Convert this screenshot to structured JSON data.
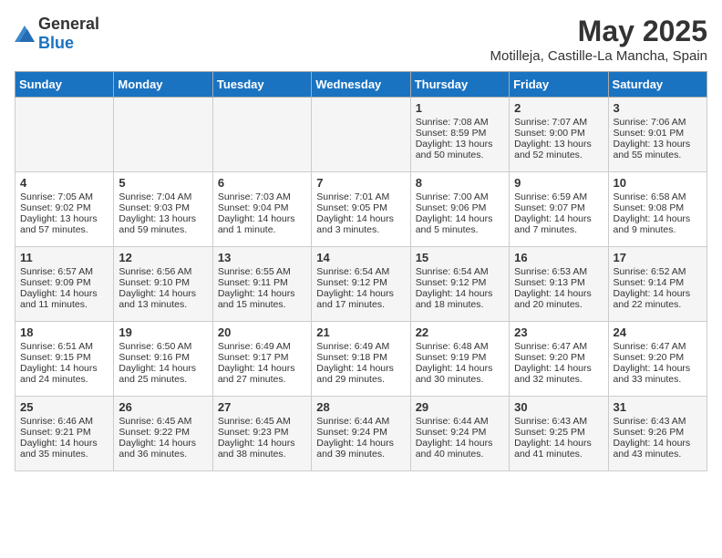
{
  "header": {
    "logo_general": "General",
    "logo_blue": "Blue",
    "title": "May 2025",
    "subtitle": "Motilleja, Castille-La Mancha, Spain"
  },
  "days": [
    "Sunday",
    "Monday",
    "Tuesday",
    "Wednesday",
    "Thursday",
    "Friday",
    "Saturday"
  ],
  "weeks": [
    [
      {
        "date": "",
        "sunrise": "",
        "sunset": "",
        "daylight": ""
      },
      {
        "date": "",
        "sunrise": "",
        "sunset": "",
        "daylight": ""
      },
      {
        "date": "",
        "sunrise": "",
        "sunset": "",
        "daylight": ""
      },
      {
        "date": "",
        "sunrise": "",
        "sunset": "",
        "daylight": ""
      },
      {
        "date": "1",
        "sunrise": "Sunrise: 7:08 AM",
        "sunset": "Sunset: 8:59 PM",
        "daylight": "Daylight: 13 hours and 50 minutes."
      },
      {
        "date": "2",
        "sunrise": "Sunrise: 7:07 AM",
        "sunset": "Sunset: 9:00 PM",
        "daylight": "Daylight: 13 hours and 52 minutes."
      },
      {
        "date": "3",
        "sunrise": "Sunrise: 7:06 AM",
        "sunset": "Sunset: 9:01 PM",
        "daylight": "Daylight: 13 hours and 55 minutes."
      }
    ],
    [
      {
        "date": "4",
        "sunrise": "Sunrise: 7:05 AM",
        "sunset": "Sunset: 9:02 PM",
        "daylight": "Daylight: 13 hours and 57 minutes."
      },
      {
        "date": "5",
        "sunrise": "Sunrise: 7:04 AM",
        "sunset": "Sunset: 9:03 PM",
        "daylight": "Daylight: 13 hours and 59 minutes."
      },
      {
        "date": "6",
        "sunrise": "Sunrise: 7:03 AM",
        "sunset": "Sunset: 9:04 PM",
        "daylight": "Daylight: 14 hours and 1 minute."
      },
      {
        "date": "7",
        "sunrise": "Sunrise: 7:01 AM",
        "sunset": "Sunset: 9:05 PM",
        "daylight": "Daylight: 14 hours and 3 minutes."
      },
      {
        "date": "8",
        "sunrise": "Sunrise: 7:00 AM",
        "sunset": "Sunset: 9:06 PM",
        "daylight": "Daylight: 14 hours and 5 minutes."
      },
      {
        "date": "9",
        "sunrise": "Sunrise: 6:59 AM",
        "sunset": "Sunset: 9:07 PM",
        "daylight": "Daylight: 14 hours and 7 minutes."
      },
      {
        "date": "10",
        "sunrise": "Sunrise: 6:58 AM",
        "sunset": "Sunset: 9:08 PM",
        "daylight": "Daylight: 14 hours and 9 minutes."
      }
    ],
    [
      {
        "date": "11",
        "sunrise": "Sunrise: 6:57 AM",
        "sunset": "Sunset: 9:09 PM",
        "daylight": "Daylight: 14 hours and 11 minutes."
      },
      {
        "date": "12",
        "sunrise": "Sunrise: 6:56 AM",
        "sunset": "Sunset: 9:10 PM",
        "daylight": "Daylight: 14 hours and 13 minutes."
      },
      {
        "date": "13",
        "sunrise": "Sunrise: 6:55 AM",
        "sunset": "Sunset: 9:11 PM",
        "daylight": "Daylight: 14 hours and 15 minutes."
      },
      {
        "date": "14",
        "sunrise": "Sunrise: 6:54 AM",
        "sunset": "Sunset: 9:12 PM",
        "daylight": "Daylight: 14 hours and 17 minutes."
      },
      {
        "date": "15",
        "sunrise": "Sunrise: 6:54 AM",
        "sunset": "Sunset: 9:12 PM",
        "daylight": "Daylight: 14 hours and 18 minutes."
      },
      {
        "date": "16",
        "sunrise": "Sunrise: 6:53 AM",
        "sunset": "Sunset: 9:13 PM",
        "daylight": "Daylight: 14 hours and 20 minutes."
      },
      {
        "date": "17",
        "sunrise": "Sunrise: 6:52 AM",
        "sunset": "Sunset: 9:14 PM",
        "daylight": "Daylight: 14 hours and 22 minutes."
      }
    ],
    [
      {
        "date": "18",
        "sunrise": "Sunrise: 6:51 AM",
        "sunset": "Sunset: 9:15 PM",
        "daylight": "Daylight: 14 hours and 24 minutes."
      },
      {
        "date": "19",
        "sunrise": "Sunrise: 6:50 AM",
        "sunset": "Sunset: 9:16 PM",
        "daylight": "Daylight: 14 hours and 25 minutes."
      },
      {
        "date": "20",
        "sunrise": "Sunrise: 6:49 AM",
        "sunset": "Sunset: 9:17 PM",
        "daylight": "Daylight: 14 hours and 27 minutes."
      },
      {
        "date": "21",
        "sunrise": "Sunrise: 6:49 AM",
        "sunset": "Sunset: 9:18 PM",
        "daylight": "Daylight: 14 hours and 29 minutes."
      },
      {
        "date": "22",
        "sunrise": "Sunrise: 6:48 AM",
        "sunset": "Sunset: 9:19 PM",
        "daylight": "Daylight: 14 hours and 30 minutes."
      },
      {
        "date": "23",
        "sunrise": "Sunrise: 6:47 AM",
        "sunset": "Sunset: 9:20 PM",
        "daylight": "Daylight: 14 hours and 32 minutes."
      },
      {
        "date": "24",
        "sunrise": "Sunrise: 6:47 AM",
        "sunset": "Sunset: 9:20 PM",
        "daylight": "Daylight: 14 hours and 33 minutes."
      }
    ],
    [
      {
        "date": "25",
        "sunrise": "Sunrise: 6:46 AM",
        "sunset": "Sunset: 9:21 PM",
        "daylight": "Daylight: 14 hours and 35 minutes."
      },
      {
        "date": "26",
        "sunrise": "Sunrise: 6:45 AM",
        "sunset": "Sunset: 9:22 PM",
        "daylight": "Daylight: 14 hours and 36 minutes."
      },
      {
        "date": "27",
        "sunrise": "Sunrise: 6:45 AM",
        "sunset": "Sunset: 9:23 PM",
        "daylight": "Daylight: 14 hours and 38 minutes."
      },
      {
        "date": "28",
        "sunrise": "Sunrise: 6:44 AM",
        "sunset": "Sunset: 9:24 PM",
        "daylight": "Daylight: 14 hours and 39 minutes."
      },
      {
        "date": "29",
        "sunrise": "Sunrise: 6:44 AM",
        "sunset": "Sunset: 9:24 PM",
        "daylight": "Daylight: 14 hours and 40 minutes."
      },
      {
        "date": "30",
        "sunrise": "Sunrise: 6:43 AM",
        "sunset": "Sunset: 9:25 PM",
        "daylight": "Daylight: 14 hours and 41 minutes."
      },
      {
        "date": "31",
        "sunrise": "Sunrise: 6:43 AM",
        "sunset": "Sunset: 9:26 PM",
        "daylight": "Daylight: 14 hours and 43 minutes."
      }
    ]
  ]
}
